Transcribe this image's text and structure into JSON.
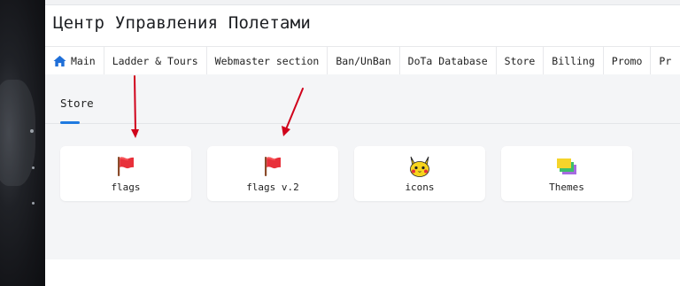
{
  "header": {
    "title": "Центр Управления Полетами"
  },
  "nav": {
    "items": [
      {
        "label": "Main",
        "icon": "home-icon"
      },
      {
        "label": "Ladder & Tours"
      },
      {
        "label": "Webmaster section"
      },
      {
        "label": "Ban/UnBan"
      },
      {
        "label": "DoTa Database"
      },
      {
        "label": "Store"
      },
      {
        "label": "Billing"
      },
      {
        "label": "Promo"
      },
      {
        "label": "Pr"
      }
    ]
  },
  "section": {
    "tab_label": "Store",
    "accent_color": "#1f7ae0"
  },
  "cards": [
    {
      "label": "flags",
      "icon": "red-flag-icon"
    },
    {
      "label": "flags v.2",
      "icon": "red-flag-icon"
    },
    {
      "label": "icons",
      "icon": "pikachu-icon"
    },
    {
      "label": "Themes",
      "icon": "themes-icon"
    }
  ],
  "annotations": {
    "arrow_color": "#d0021b"
  }
}
